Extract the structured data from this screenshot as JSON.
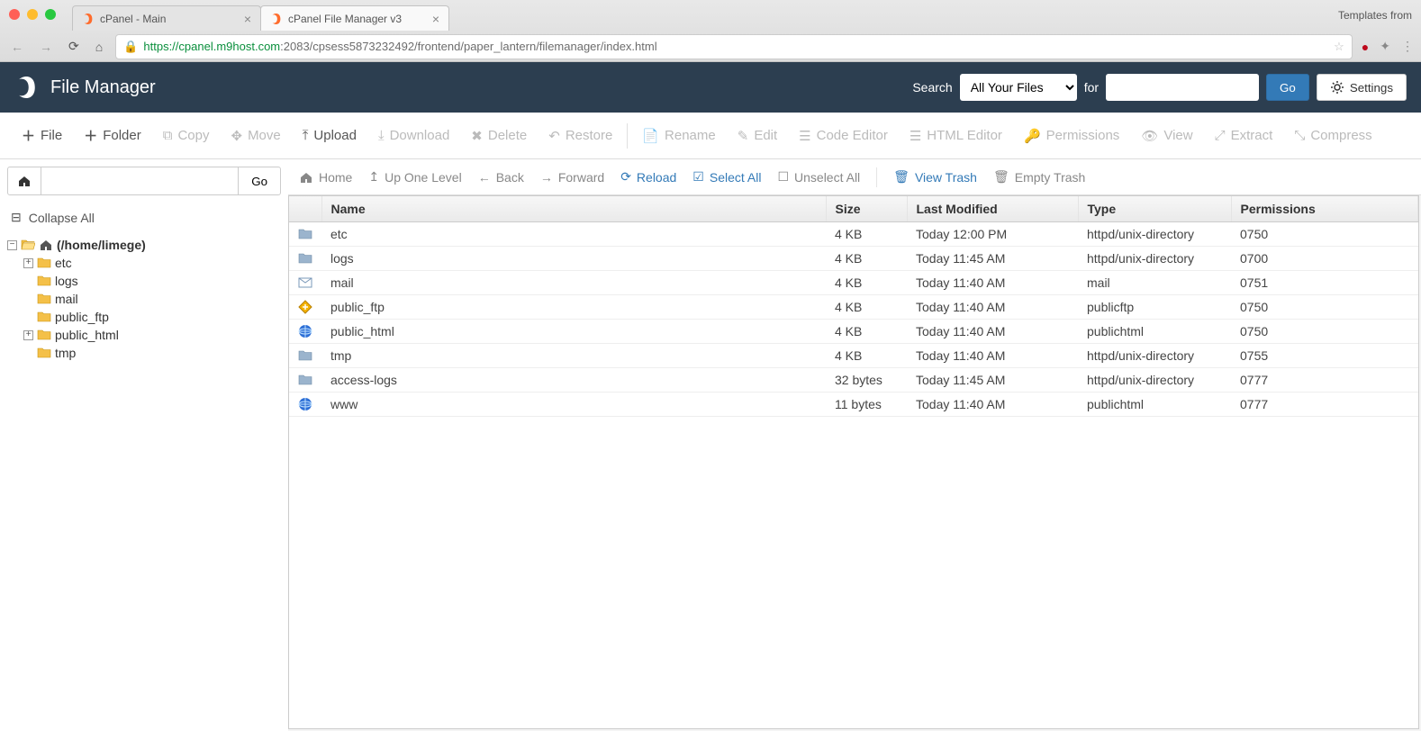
{
  "browser": {
    "tabs": [
      {
        "title": "cPanel - Main",
        "active": false
      },
      {
        "title": "cPanel File Manager v3",
        "active": true
      }
    ],
    "templates_label": "Templates from",
    "url_host": "https://cpanel.m9host.com",
    "url_path": ":2083/cpsess5873232492/frontend/paper_lantern/filemanager/index.html"
  },
  "header": {
    "app_title": "File Manager",
    "search_label": "Search",
    "search_scope": "All Your Files",
    "for_label": "for",
    "go_label": "Go",
    "settings_label": "Settings"
  },
  "toolbar": {
    "file": "File",
    "folder": "Folder",
    "copy": "Copy",
    "move": "Move",
    "upload": "Upload",
    "download": "Download",
    "delete": "Delete",
    "restore": "Restore",
    "rename": "Rename",
    "edit": "Edit",
    "code_editor": "Code Editor",
    "html_editor": "HTML Editor",
    "permissions": "Permissions",
    "view": "View",
    "extract": "Extract",
    "compress": "Compress"
  },
  "sidebar": {
    "go_label": "Go",
    "collapse_all": "Collapse All",
    "root_label": "(/home/limege)",
    "nodes": [
      {
        "name": "etc",
        "expandable": true
      },
      {
        "name": "logs",
        "expandable": false
      },
      {
        "name": "mail",
        "expandable": false
      },
      {
        "name": "public_ftp",
        "expandable": false
      },
      {
        "name": "public_html",
        "expandable": true
      },
      {
        "name": "tmp",
        "expandable": false
      }
    ]
  },
  "navrow": {
    "home": "Home",
    "up": "Up One Level",
    "back": "Back",
    "forward": "Forward",
    "reload": "Reload",
    "select_all": "Select All",
    "unselect_all": "Unselect All",
    "view_trash": "View Trash",
    "empty_trash": "Empty Trash"
  },
  "columns": {
    "name": "Name",
    "size": "Size",
    "modified": "Last Modified",
    "type": "Type",
    "perms": "Permissions"
  },
  "rows": [
    {
      "icon": "folder",
      "name": "etc",
      "size": "4 KB",
      "modified": "Today 12:00 PM",
      "type": "httpd/unix-directory",
      "perms": "0750"
    },
    {
      "icon": "folder",
      "name": "logs",
      "size": "4 KB",
      "modified": "Today 11:45 AM",
      "type": "httpd/unix-directory",
      "perms": "0700"
    },
    {
      "icon": "mail",
      "name": "mail",
      "size": "4 KB",
      "modified": "Today 11:40 AM",
      "type": "mail",
      "perms": "0751"
    },
    {
      "icon": "ftp",
      "name": "public_ftp",
      "size": "4 KB",
      "modified": "Today 11:40 AM",
      "type": "publicftp",
      "perms": "0750"
    },
    {
      "icon": "globe",
      "name": "public_html",
      "size": "4 KB",
      "modified": "Today 11:40 AM",
      "type": "publichtml",
      "perms": "0750"
    },
    {
      "icon": "folder",
      "name": "tmp",
      "size": "4 KB",
      "modified": "Today 11:40 AM",
      "type": "httpd/unix-directory",
      "perms": "0755"
    },
    {
      "icon": "folder",
      "name": "access-logs",
      "size": "32 bytes",
      "modified": "Today 11:45 AM",
      "type": "httpd/unix-directory",
      "perms": "0777"
    },
    {
      "icon": "globe",
      "name": "www",
      "size": "11 bytes",
      "modified": "Today 11:40 AM",
      "type": "publichtml",
      "perms": "0777"
    }
  ]
}
